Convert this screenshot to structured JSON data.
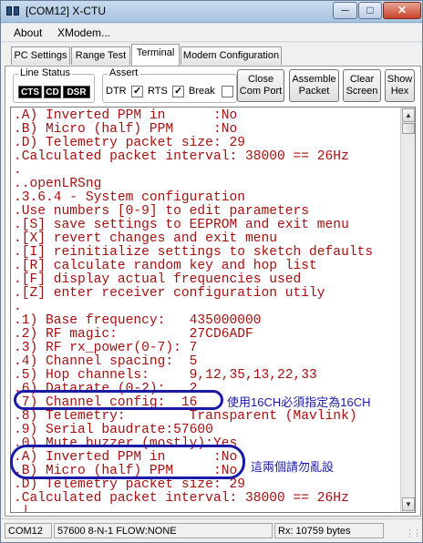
{
  "window": {
    "title": "[COM12] X-CTU"
  },
  "menu": {
    "items": [
      "About",
      "XModem..."
    ]
  },
  "tabs": [
    "PC Settings",
    "Range Test",
    "Terminal",
    "Modem Configuration"
  ],
  "line_status": {
    "title": "Line Status",
    "leds": [
      "CTS",
      "CD",
      "DSR"
    ]
  },
  "assert": {
    "title": "Assert",
    "dtr": "DTR",
    "rts": "RTS",
    "brk": "Break",
    "dtr_checked": true,
    "rts_checked": true,
    "break_checked": false
  },
  "buttons": {
    "close_port": [
      "Close",
      "Com Port"
    ],
    "assemble": [
      "Assemble",
      "Packet"
    ],
    "clear": [
      "Clear",
      "Screen"
    ],
    "show_hex": [
      "Show",
      "Hex"
    ]
  },
  "terminal": {
    "lines": [
      ".A) Inverted PPM in      :No",
      ".B) Micro (half) PPM     :No",
      ".D) Telemetry packet size: 29",
      ".Calculated packet interval: 38000 == 26Hz",
      ".",
      "..openLRSng",
      ".3.6.4 - System configuration",
      ".Use numbers [0-9] to edit parameters",
      ".[S] save settings to EEPROM and exit menu",
      ".[X] revert changes and exit menu",
      ".[I] reinitialize settings to sketch defaults",
      ".[R] calculate random key and hop list",
      ".[F] display actual frequencies used",
      ".[Z] enter receiver configuration utily",
      ".",
      ".1) Base frequency:   435000000",
      ".2) RF magic:         27CD6ADF",
      ".3) RF rx_power(0-7): 7",
      ".4) Channel spacing:  5",
      ".5) Hop channels:     9,12,35,13,22,33",
      ".6) Datarate (0-2):   2",
      ".7) Channel config:  16",
      ".8) Telemetry:        Transparent (Mavlink)",
      ".9) Serial baudrate:57600",
      ".0) Mute buzzer (mostly):Yes",
      ".A) Inverted PPM in      :No",
      ".B) Micro (half) PPM     :No",
      ".D) Telemetry packet size: 29",
      ".Calculated packet interval: 38000 == 26Hz",
      ".|"
    ]
  },
  "annotations": {
    "note1": "使用16CH必須指定為16CH",
    "note2": "這兩個請勿亂設",
    "color": "#1a1aa8"
  },
  "statusbar": {
    "port": "COM12",
    "settings": "57600 8-N-1  FLOW:NONE",
    "rx": "Rx: 10759 bytes"
  },
  "colors": {
    "terminal_text": "#a51010"
  }
}
